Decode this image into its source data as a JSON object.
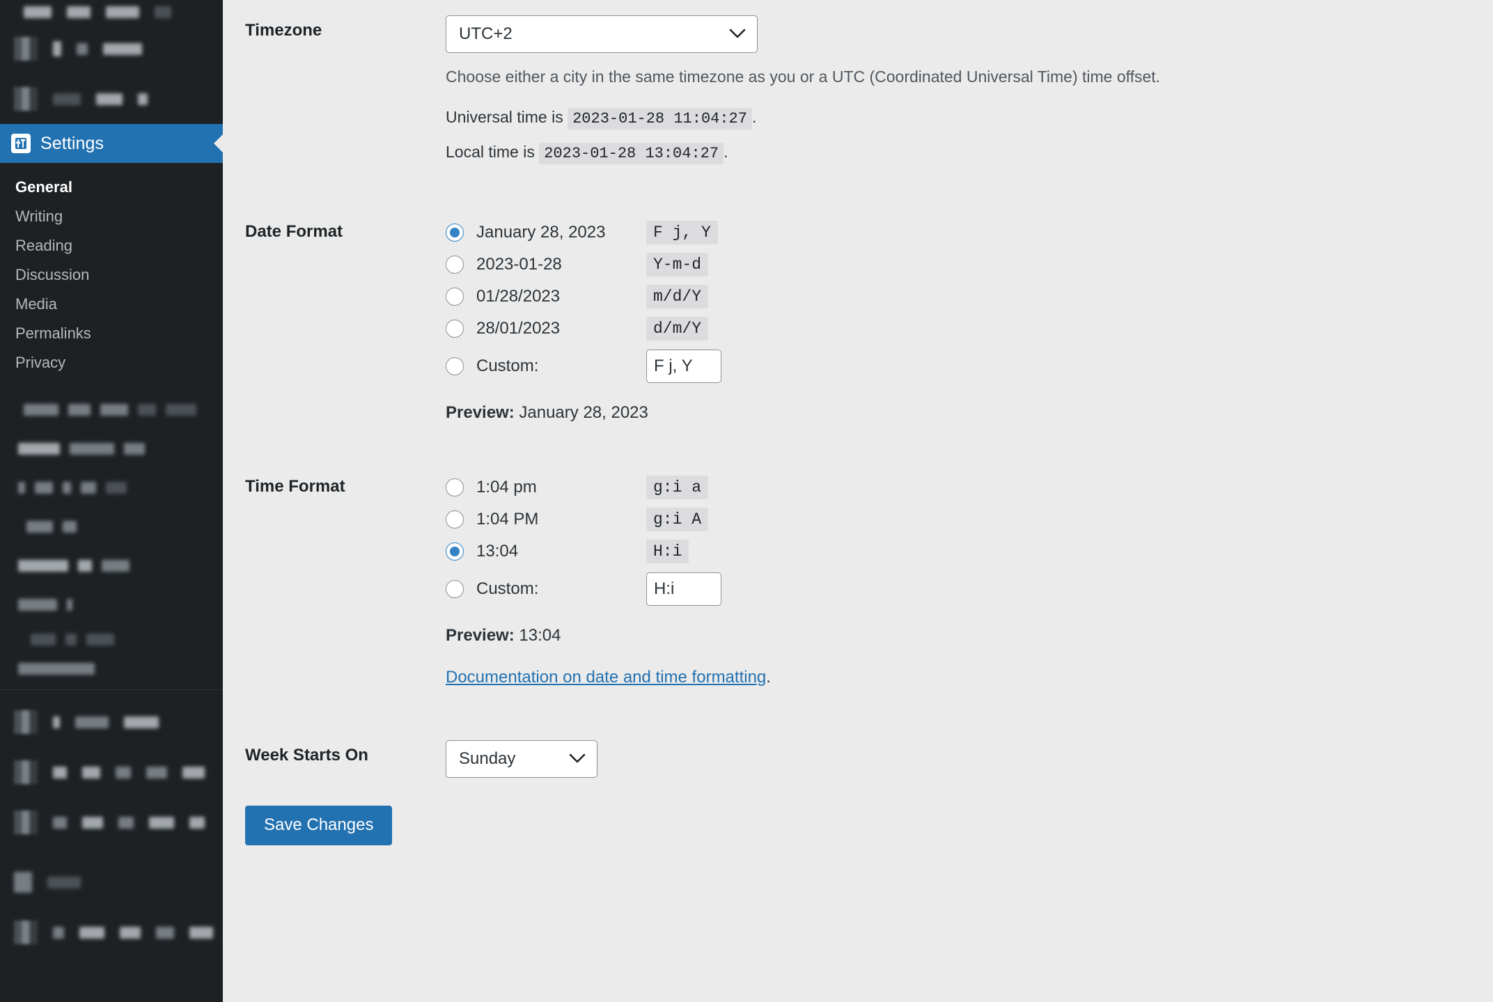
{
  "colors": {
    "sidebar_bg": "#1d2124",
    "active_menu_bg": "#2271b1",
    "content_bg": "#ebebeb",
    "accent_blue": "#2271b1",
    "radio_checked": "#3582c4",
    "link_blue": "#2271b1",
    "code_bg": "#dcdcde"
  },
  "sidebar": {
    "active_item": {
      "label": "Settings",
      "icon": "settings-sliders-icon"
    },
    "submenu": [
      {
        "label": "General",
        "current": true
      },
      {
        "label": "Writing",
        "current": false
      },
      {
        "label": "Reading",
        "current": false
      },
      {
        "label": "Discussion",
        "current": false
      },
      {
        "label": "Media",
        "current": false
      },
      {
        "label": "Permalinks",
        "current": false
      },
      {
        "label": "Privacy",
        "current": false
      }
    ]
  },
  "main": {
    "timezone": {
      "label": "Timezone",
      "selected": "UTC+2",
      "description": "Choose either a city in the same timezone as you or a UTC (Coordinated Universal Time) time offset.",
      "universal_time_prefix": "Universal time is",
      "universal_time_value": "2023-01-28 11:04:27",
      "universal_time_suffix": ".",
      "local_time_prefix": "Local time is",
      "local_time_value": "2023-01-28 13:04:27",
      "local_time_suffix": "."
    },
    "date_format": {
      "label": "Date Format",
      "options": [
        {
          "label": "January 28, 2023",
          "code": "F j, Y",
          "checked": true
        },
        {
          "label": "2023-01-28",
          "code": "Y-m-d",
          "checked": false
        },
        {
          "label": "01/28/2023",
          "code": "m/d/Y",
          "checked": false
        },
        {
          "label": "28/01/2023",
          "code": "d/m/Y",
          "checked": false
        }
      ],
      "custom_label": "Custom:",
      "custom_checked": false,
      "custom_value": "F j, Y",
      "preview_label": "Preview:",
      "preview_value": "January 28, 2023"
    },
    "time_format": {
      "label": "Time Format",
      "options": [
        {
          "label": "1:04 pm",
          "code": "g:i a",
          "checked": false
        },
        {
          "label": "1:04 PM",
          "code": "g:i A",
          "checked": false
        },
        {
          "label": "13:04",
          "code": "H:i",
          "checked": true
        }
      ],
      "custom_label": "Custom:",
      "custom_checked": false,
      "custom_value": "H:i",
      "preview_label": "Preview:",
      "preview_value": "13:04",
      "doc_link": "Documentation on date and time formatting",
      "doc_link_suffix": "."
    },
    "week_starts_on": {
      "label": "Week Starts On",
      "selected": "Sunday"
    },
    "save_button": "Save Changes"
  }
}
